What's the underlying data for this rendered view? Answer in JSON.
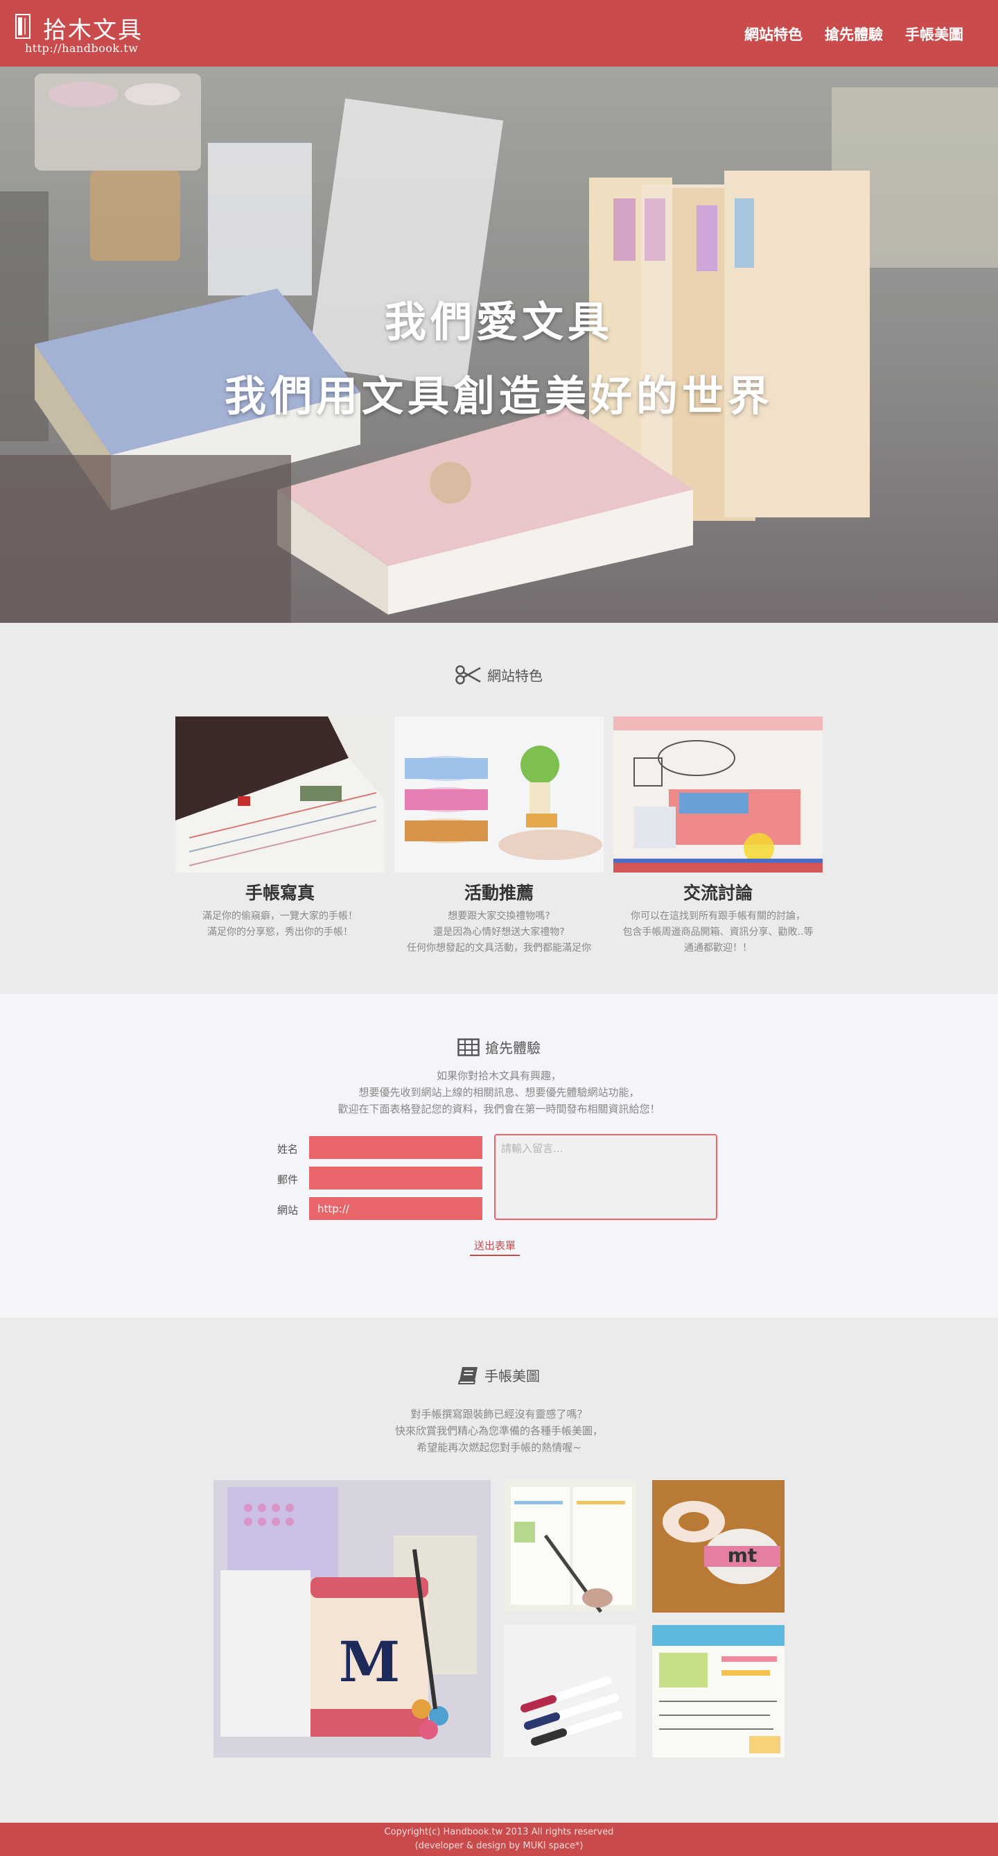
{
  "site": {
    "logo_text": "拾木文具",
    "logo_url": "http://handbook.tw"
  },
  "nav": {
    "items": [
      "網站特色",
      "搶先體驗",
      "手帳美圖"
    ]
  },
  "hero": {
    "line1": "我們愛文具",
    "line2": "我們用文具創造美好的世界"
  },
  "features": {
    "title": "網站特色",
    "icon": "scissors-icon",
    "cards": [
      {
        "title": "手帳寫真",
        "lines": [
          "滿足你的偷窺癖，一覽大家的手帳！",
          "滿足你的分享慾，秀出你的手帳！"
        ]
      },
      {
        "title": "活動推薦",
        "lines": [
          "想要跟大家交換禮物嗎?",
          "還是因為心情好想送大家禮物?",
          "任何你想發起的文具活動，我們都能滿足你"
        ]
      },
      {
        "title": "交流討論",
        "lines": [
          "你可以在這找到所有跟手帳有關的討論，",
          "包含手帳周邊商品開箱、資訊分享、勸敗..等",
          "通通都歡迎！！"
        ]
      }
    ]
  },
  "try": {
    "title": "搶先體驗",
    "icon": "grid-icon",
    "desc": [
      "如果你對拾木文具有興趣，",
      "想要優先收到網站上線的相關訊息、想要優先體驗網站功能，",
      "歡迎在下面表格登記您的資料，我們會在第一時間發布相關資訊給您！"
    ],
    "form": {
      "name_label": "姓名",
      "email_label": "郵件",
      "site_label": "網站",
      "site_value": "http://",
      "message_placeholder": "請輸入留言...",
      "submit_label": "送出表單"
    }
  },
  "gallery": {
    "title": "手帳美圖",
    "icon": "book-icon",
    "desc": [
      "對手帳撰寫跟裝飾已經沒有靈感了嗎？",
      "快來欣賞我們精心為您準備的各種手帳美圖，",
      "希望能再次燃起您對手帳的熱情喔~"
    ]
  },
  "footer": {
    "line1": "Copyright(c) Handbook.tw 2013 All rights reserved",
    "line2": "(developer & design by MUKI space*)"
  },
  "colors": {
    "brand_red": "#c94b4b",
    "input_red": "#e8656a",
    "section_gray": "#ebebeb",
    "section_light": "#f4f5f8"
  }
}
